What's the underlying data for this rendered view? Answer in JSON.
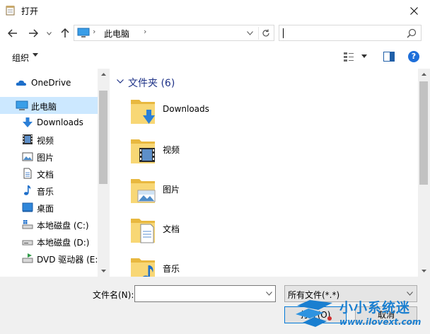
{
  "window": {
    "title": "打开"
  },
  "address": {
    "location": "此电脑",
    "sep": "›"
  },
  "search": {
    "value": ""
  },
  "toolbar": {
    "organize_label": "组织",
    "help_label": "?"
  },
  "sidebar": {
    "items": [
      {
        "label": "OneDrive",
        "icon": "onedrive-icon"
      },
      {
        "label": "此电脑",
        "icon": "pc-icon",
        "selected": true
      },
      {
        "label": "Downloads",
        "icon": "downloads-icon"
      },
      {
        "label": "视频",
        "icon": "video-icon"
      },
      {
        "label": "图片",
        "icon": "pictures-icon"
      },
      {
        "label": "文档",
        "icon": "documents-icon"
      },
      {
        "label": "音乐",
        "icon": "music-icon"
      },
      {
        "label": "桌面",
        "icon": "desktop-icon"
      },
      {
        "label": "本地磁盘 (C:)",
        "icon": "drive-c-icon"
      },
      {
        "label": "本地磁盘 (D:)",
        "icon": "drive-d-icon"
      },
      {
        "label": "DVD 驱动器 (E:)",
        "icon": "dvd-drive-icon"
      }
    ]
  },
  "content": {
    "group_header": "文件夹 (6)",
    "folders": [
      {
        "label": "Downloads",
        "icon": "downloads-folder-icon"
      },
      {
        "label": "视频",
        "icon": "video-folder-icon"
      },
      {
        "label": "图片",
        "icon": "pictures-folder-icon"
      },
      {
        "label": "文档",
        "icon": "documents-folder-icon"
      },
      {
        "label": "音乐",
        "icon": "music-folder-icon"
      }
    ]
  },
  "bottom": {
    "filename_label": "文件名(N):",
    "filename_value": "",
    "filter_value": "所有文件(*.*)",
    "open_label": "打开(O)",
    "cancel_label": "取消"
  },
  "watermark": {
    "cn": "小小系统迷",
    "url": "www.ilovext.com"
  },
  "colors": {
    "accent": "#0078d7",
    "selected": "#cce8ff",
    "group_header": "#1e3287",
    "folder": "#f8d775",
    "watermark": "#1a7fd0"
  }
}
